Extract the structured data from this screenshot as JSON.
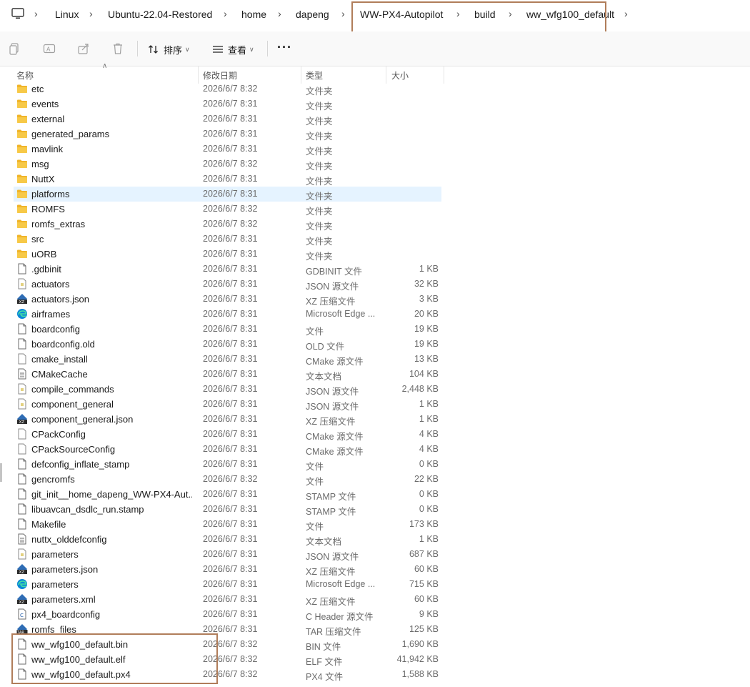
{
  "breadcrumb": [
    "Linux",
    "Ubuntu-22.04-Restored",
    "home",
    "dapeng",
    "WW-PX4-Autopilot",
    "build",
    "ww_wfg100_default"
  ],
  "toolbar": {
    "sort_label": "排序",
    "view_label": "查看",
    "more_label": "···"
  },
  "columns": {
    "name": "名称",
    "date": "修改日期",
    "type": "类型",
    "size": "大小"
  },
  "files": [
    {
      "name": "etc",
      "date": "2026/6/7 8:32",
      "type": "文件夹",
      "size": "",
      "icon": "folder-icon"
    },
    {
      "name": "events",
      "date": "2026/6/7 8:31",
      "type": "文件夹",
      "size": "",
      "icon": "folder-icon"
    },
    {
      "name": "external",
      "date": "2026/6/7 8:31",
      "type": "文件夹",
      "size": "",
      "icon": "folder-icon"
    },
    {
      "name": "generated_params",
      "date": "2026/6/7 8:31",
      "type": "文件夹",
      "size": "",
      "icon": "folder-icon"
    },
    {
      "name": "mavlink",
      "date": "2026/6/7 8:31",
      "type": "文件夹",
      "size": "",
      "icon": "folder-icon"
    },
    {
      "name": "msg",
      "date": "2026/6/7 8:32",
      "type": "文件夹",
      "size": "",
      "icon": "folder-icon"
    },
    {
      "name": "NuttX",
      "date": "2026/6/7 8:31",
      "type": "文件夹",
      "size": "",
      "icon": "folder-icon"
    },
    {
      "name": "platforms",
      "date": "2026/6/7 8:31",
      "type": "文件夹",
      "size": "",
      "icon": "folder-icon",
      "selected": true
    },
    {
      "name": "ROMFS",
      "date": "2026/6/7 8:32",
      "type": "文件夹",
      "size": "",
      "icon": "folder-icon"
    },
    {
      "name": "romfs_extras",
      "date": "2026/6/7 8:32",
      "type": "文件夹",
      "size": "",
      "icon": "folder-icon"
    },
    {
      "name": "src",
      "date": "2026/6/7 8:31",
      "type": "文件夹",
      "size": "",
      "icon": "folder-icon"
    },
    {
      "name": "uORB",
      "date": "2026/6/7 8:31",
      "type": "文件夹",
      "size": "",
      "icon": "folder-icon"
    },
    {
      "name": ".gdbinit",
      "date": "2026/6/7 8:31",
      "type": "GDBINIT 文件",
      "size": "1 KB",
      "icon": "file-icon"
    },
    {
      "name": "actuators",
      "date": "2026/6/7 8:31",
      "type": "JSON 源文件",
      "size": "32 KB",
      "icon": "json-file-icon"
    },
    {
      "name": "actuators.json",
      "date": "2026/6/7 8:31",
      "type": "XZ 压缩文件",
      "size": "3 KB",
      "icon": "xz-archive-icon"
    },
    {
      "name": "airframes",
      "date": "2026/6/7 8:31",
      "type": "Microsoft Edge ...",
      "size": "20 KB",
      "icon": "edge-icon"
    },
    {
      "name": "boardconfig",
      "date": "2026/6/7 8:31",
      "type": "文件",
      "size": "19 KB",
      "icon": "file-icon"
    },
    {
      "name": "boardconfig.old",
      "date": "2026/6/7 8:31",
      "type": "OLD 文件",
      "size": "19 KB",
      "icon": "file-icon"
    },
    {
      "name": "cmake_install",
      "date": "2026/6/7 8:31",
      "type": "CMake 源文件",
      "size": "13 KB",
      "icon": "cmake-file-icon"
    },
    {
      "name": "CMakeCache",
      "date": "2026/6/7 8:31",
      "type": "文本文档",
      "size": "104 KB",
      "icon": "text-file-icon"
    },
    {
      "name": "compile_commands",
      "date": "2026/6/7 8:31",
      "type": "JSON 源文件",
      "size": "2,448 KB",
      "icon": "json-file-icon"
    },
    {
      "name": "component_general",
      "date": "2026/6/7 8:31",
      "type": "JSON 源文件",
      "size": "1 KB",
      "icon": "json-file-icon"
    },
    {
      "name": "component_general.json",
      "date": "2026/6/7 8:31",
      "type": "XZ 压缩文件",
      "size": "1 KB",
      "icon": "xz-archive-icon"
    },
    {
      "name": "CPackConfig",
      "date": "2026/6/7 8:31",
      "type": "CMake 源文件",
      "size": "4 KB",
      "icon": "cmake-file-icon"
    },
    {
      "name": "CPackSourceConfig",
      "date": "2026/6/7 8:31",
      "type": "CMake 源文件",
      "size": "4 KB",
      "icon": "cmake-file-icon"
    },
    {
      "name": "defconfig_inflate_stamp",
      "date": "2026/6/7 8:31",
      "type": "文件",
      "size": "0 KB",
      "icon": "file-icon"
    },
    {
      "name": "gencromfs",
      "date": "2026/6/7 8:32",
      "type": "文件",
      "size": "22 KB",
      "icon": "file-icon"
    },
    {
      "name": "git_init__home_dapeng_WW-PX4-Aut...",
      "date": "2026/6/7 8:31",
      "type": "STAMP 文件",
      "size": "0 KB",
      "icon": "file-icon"
    },
    {
      "name": "libuavcan_dsdlc_run.stamp",
      "date": "2026/6/7 8:31",
      "type": "STAMP 文件",
      "size": "0 KB",
      "icon": "file-icon"
    },
    {
      "name": "Makefile",
      "date": "2026/6/7 8:31",
      "type": "文件",
      "size": "173 KB",
      "icon": "file-icon"
    },
    {
      "name": "nuttx_olddefconfig",
      "date": "2026/6/7 8:31",
      "type": "文本文档",
      "size": "1 KB",
      "icon": "text-file-icon"
    },
    {
      "name": "parameters",
      "date": "2026/6/7 8:31",
      "type": "JSON 源文件",
      "size": "687 KB",
      "icon": "json-file-icon"
    },
    {
      "name": "parameters.json",
      "date": "2026/6/7 8:31",
      "type": "XZ 压缩文件",
      "size": "60 KB",
      "icon": "xz-archive-icon"
    },
    {
      "name": "parameters",
      "date": "2026/6/7 8:31",
      "type": "Microsoft Edge ...",
      "size": "715 KB",
      "icon": "edge-icon"
    },
    {
      "name": "parameters.xml",
      "date": "2026/6/7 8:31",
      "type": "XZ 压缩文件",
      "size": "60 KB",
      "icon": "xz-archive-icon"
    },
    {
      "name": "px4_boardconfig",
      "date": "2026/6/7 8:31",
      "type": "C Header 源文件",
      "size": "9 KB",
      "icon": "c-header-file-icon"
    },
    {
      "name": "romfs_files",
      "date": "2026/6/7 8:31",
      "type": "TAR 压缩文件",
      "size": "125 KB",
      "icon": "tar-archive-icon"
    },
    {
      "name": "ww_wfg100_default.bin",
      "date": "2026/6/7 8:32",
      "type": "BIN 文件",
      "size": "1,690 KB",
      "icon": "file-icon"
    },
    {
      "name": "ww_wfg100_default.elf",
      "date": "2026/6/7 8:32",
      "type": "ELF 文件",
      "size": "41,942 KB",
      "icon": "file-icon"
    },
    {
      "name": "ww_wfg100_default.px4",
      "date": "2026/6/7 8:32",
      "type": "PX4 文件",
      "size": "1,588 KB",
      "icon": "file-icon"
    }
  ],
  "colors": {
    "highlight_box": "#b07d5a",
    "selected_row": "#e5f3ff",
    "folder": "#f7c948"
  }
}
